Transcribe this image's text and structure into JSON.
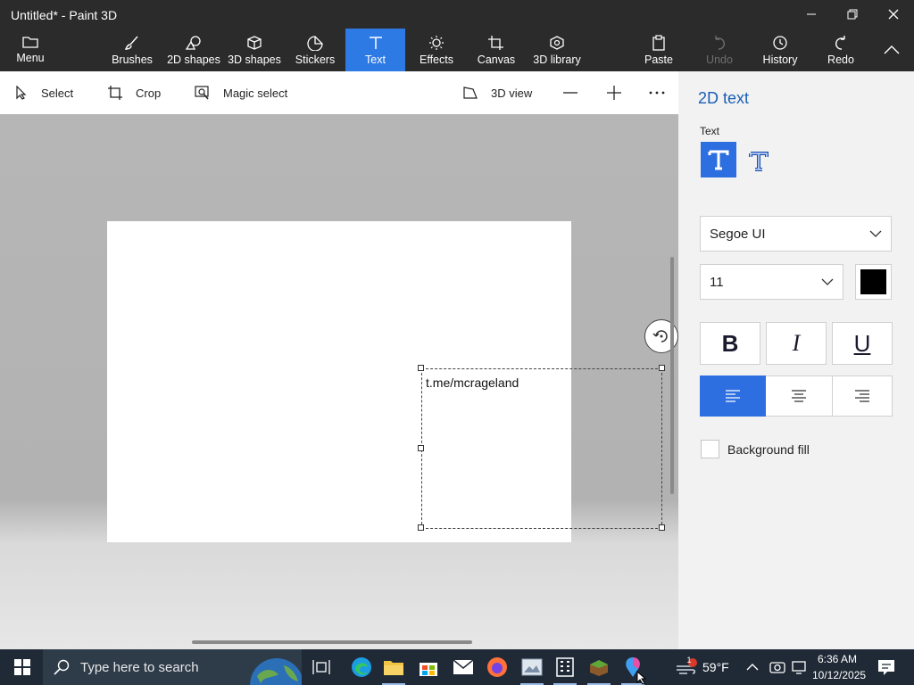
{
  "window": {
    "title": "Untitled* - Paint 3D",
    "minimize_icon": "minimize-icon",
    "restore_icon": "restore-icon",
    "close_icon": "close-icon"
  },
  "toolbar": {
    "menu": "Menu",
    "brushes": "Brushes",
    "shapes2d": "2D shapes",
    "shapes3d": "3D shapes",
    "stickers": "Stickers",
    "text": "Text",
    "effects": "Effects",
    "canvas": "Canvas",
    "library3d": "3D library",
    "paste": "Paste",
    "undo": "Undo",
    "history": "History",
    "redo": "Redo",
    "active_color": "#2d7ae5"
  },
  "subbar": {
    "select": "Select",
    "crop": "Crop",
    "magic_select": "Magic select",
    "view3d": "3D view",
    "zoom_out_icon": "minus-icon",
    "zoom_in_icon": "plus-icon",
    "more_icon": "more-icon"
  },
  "canvas": {
    "text_content": "t.me/mcrageland"
  },
  "panel": {
    "title": "2D text",
    "text_label": "Text",
    "font": "Segoe UI",
    "size": "11",
    "color": "#000000",
    "bold": "B",
    "italic": "I",
    "underline": "U",
    "background_fill": "Background fill",
    "accent": "#2d6fe0"
  },
  "taskbar": {
    "search_placeholder": "Type here to search",
    "temperature": "59°F",
    "time": "6:36 AM",
    "date": "10/12/2025",
    "notification_count": "1"
  }
}
